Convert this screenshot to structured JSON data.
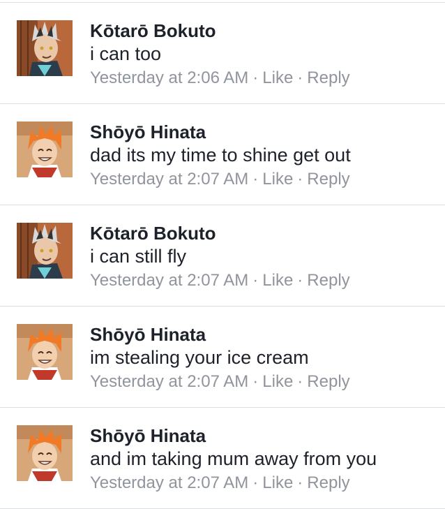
{
  "comments": [
    {
      "author": "Kōtarō Bokuto",
      "text": "i can too",
      "time": "Yesterday at 2:06 AM",
      "like": "Like",
      "reply": "Reply",
      "avatar": "bokuto-avatar"
    },
    {
      "author": "Shōyō Hinata",
      "text": "dad its my time to shine get out",
      "time": "Yesterday at 2:07 AM",
      "like": "Like",
      "reply": "Reply",
      "avatar": "hinata-avatar"
    },
    {
      "author": "Kōtarō Bokuto",
      "text": "i can still fly",
      "time": "Yesterday at 2:07 AM",
      "like": "Like",
      "reply": "Reply",
      "avatar": "bokuto-avatar"
    },
    {
      "author": "Shōyō Hinata",
      "text": "im stealing your ice cream",
      "time": "Yesterday at 2:07 AM",
      "like": "Like",
      "reply": "Reply",
      "avatar": "hinata-avatar"
    },
    {
      "author": "Shōyō Hinata",
      "text": "and im taking mum away from you",
      "time": "Yesterday at 2:07 AM",
      "like": "Like",
      "reply": "Reply",
      "avatar": "hinata-avatar"
    }
  ],
  "separator": "·",
  "colors": {
    "name": "#1d2129",
    "meta": "#90949c",
    "divider": "#dcdde0"
  }
}
